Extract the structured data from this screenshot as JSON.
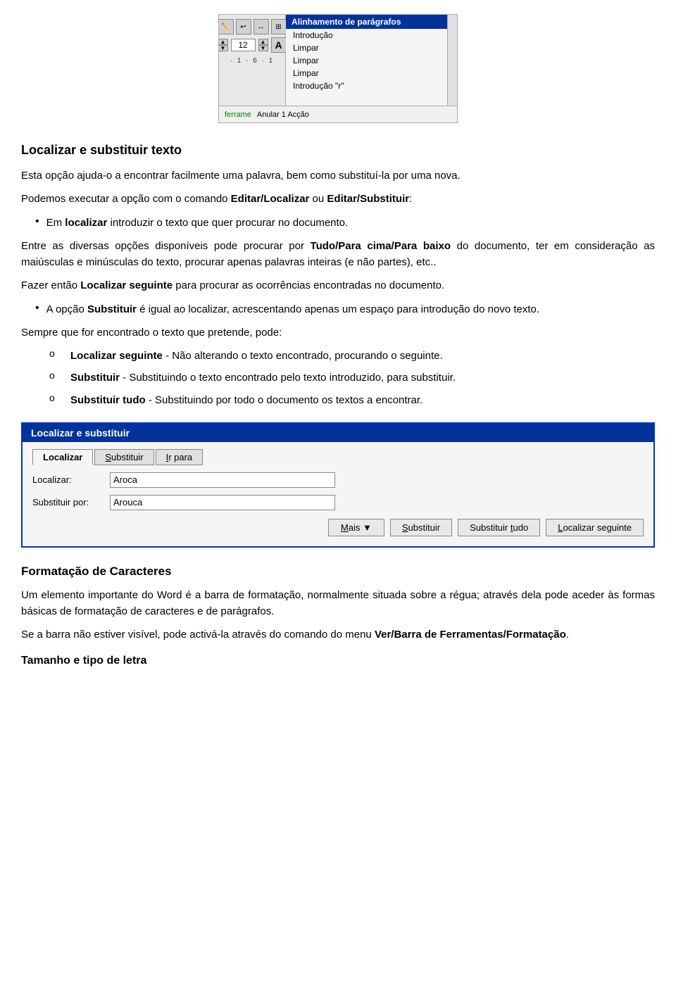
{
  "toolbar": {
    "num_value": "12",
    "menu_title": "Alinhamento de parágrafos",
    "menu_items": [
      {
        "label": "Introdução",
        "selected": false
      },
      {
        "label": "Limpar",
        "selected": false
      },
      {
        "label": "Limpar",
        "selected": false
      },
      {
        "label": "Limpar",
        "selected": false
      },
      {
        "label": "Introdução \"r\"",
        "selected": false
      }
    ],
    "bottom_text": "Anular 1 Acção",
    "ferrame_label": "ferrame"
  },
  "section1": {
    "title": "Localizar e substituir texto",
    "intro1": "Esta opção ajuda-o a encontrar facilmente uma palavra, bem como substituí-la por uma nova.",
    "intro2": "Podemos executar a opção com o comando Editar/Localizar ou Editar/Substituir:",
    "bullet1": "Em localizar introduzir o texto que quer procurar no documento.",
    "para1": "Entre as diversas opções disponíveis pode procurar por Tudo/Para cima/Para baixo do documento, ter em consideração as maiúsculas e minúsculas do texto, procurar apenas palavras inteiras (e não partes), etc..",
    "para2": "Fazer então Localizar seguinte para procurar as ocorrências encontradas no documento.",
    "bullet2": "A opção Substituir é igual ao localizar, acrescentando apenas um espaço para introdução do novo texto.",
    "para3": "Sempre que for encontrado o texto que pretende, pode:",
    "sublist": [
      {
        "label": "Localizar seguinte",
        "text": " - Não alterando o texto encontrado, procurando o seguinte."
      },
      {
        "label": "Substituir",
        "text": " - Substituindo o texto encontrado pelo texto introduzido, para substituir."
      },
      {
        "label": "Substituir tudo",
        "text": " - Substituindo por todo o documento os textos a encontrar."
      }
    ]
  },
  "dialog": {
    "title": "Localizar e substituir",
    "tabs": [
      {
        "label": "Localizar",
        "underline_char": "",
        "active": true
      },
      {
        "label": "Substituir",
        "underline_char": "S",
        "active": false
      },
      {
        "label": "Ir para",
        "underline_char": "I",
        "active": false
      }
    ],
    "field1_label": "Localizar:",
    "field1_value": "Aroca",
    "field2_label": "Substituir por:",
    "field2_value": "Arouca",
    "buttons": [
      {
        "label": "Mais ▼",
        "underline_char": "M"
      },
      {
        "label": "Substituir",
        "underline_char": "S"
      },
      {
        "label": "Substituir tudo",
        "underline_char": "t"
      },
      {
        "label": "Localizar seguinte",
        "underline_char": "L"
      }
    ]
  },
  "section2": {
    "title": "Formatação de Caracteres",
    "para1": "Um elemento importante do Word é a barra de formatação, normalmente situada sobre a régua; através dela pode aceder às formas básicas de formatação de caracteres e de parágrafos.",
    "para2": "Se a barra não estiver visível, pode activá-la através do comando do menu Ver/Barra de Ferramentas/Formatação.",
    "title2": "Tamanho e tipo de letra"
  }
}
